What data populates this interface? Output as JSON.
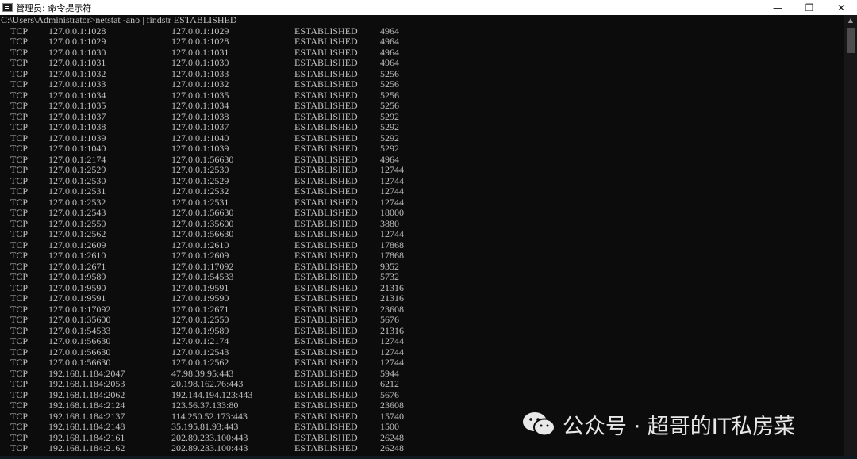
{
  "window": {
    "title": "管理员: 命令提示符",
    "minimize_glyph": "—",
    "maximize_glyph": "❐",
    "close_glyph": "✕",
    "icon": "cmd-icon"
  },
  "console": {
    "command": "C:\\Users\\Administrator>netstat -ano | findstr ESTABLISHED",
    "rows": [
      [
        "TCP",
        "127.0.0.1:1028",
        "127.0.0.1:1029",
        "ESTABLISHED",
        "4964"
      ],
      [
        "TCP",
        "127.0.0.1:1029",
        "127.0.0.1:1028",
        "ESTABLISHED",
        "4964"
      ],
      [
        "TCP",
        "127.0.0.1:1030",
        "127.0.0.1:1031",
        "ESTABLISHED",
        "4964"
      ],
      [
        "TCP",
        "127.0.0.1:1031",
        "127.0.0.1:1030",
        "ESTABLISHED",
        "4964"
      ],
      [
        "TCP",
        "127.0.0.1:1032",
        "127.0.0.1:1033",
        "ESTABLISHED",
        "5256"
      ],
      [
        "TCP",
        "127.0.0.1:1033",
        "127.0.0.1:1032",
        "ESTABLISHED",
        "5256"
      ],
      [
        "TCP",
        "127.0.0.1:1034",
        "127.0.0.1:1035",
        "ESTABLISHED",
        "5256"
      ],
      [
        "TCP",
        "127.0.0.1:1035",
        "127.0.0.1:1034",
        "ESTABLISHED",
        "5256"
      ],
      [
        "TCP",
        "127.0.0.1:1037",
        "127.0.0.1:1038",
        "ESTABLISHED",
        "5292"
      ],
      [
        "TCP",
        "127.0.0.1:1038",
        "127.0.0.1:1037",
        "ESTABLISHED",
        "5292"
      ],
      [
        "TCP",
        "127.0.0.1:1039",
        "127.0.0.1:1040",
        "ESTABLISHED",
        "5292"
      ],
      [
        "TCP",
        "127.0.0.1:1040",
        "127.0.0.1:1039",
        "ESTABLISHED",
        "5292"
      ],
      [
        "TCP",
        "127.0.0.1:2174",
        "127.0.0.1:56630",
        "ESTABLISHED",
        "4964"
      ],
      [
        "TCP",
        "127.0.0.1:2529",
        "127.0.0.1:2530",
        "ESTABLISHED",
        "12744"
      ],
      [
        "TCP",
        "127.0.0.1:2530",
        "127.0.0.1:2529",
        "ESTABLISHED",
        "12744"
      ],
      [
        "TCP",
        "127.0.0.1:2531",
        "127.0.0.1:2532",
        "ESTABLISHED",
        "12744"
      ],
      [
        "TCP",
        "127.0.0.1:2532",
        "127.0.0.1:2531",
        "ESTABLISHED",
        "12744"
      ],
      [
        "TCP",
        "127.0.0.1:2543",
        "127.0.0.1:56630",
        "ESTABLISHED",
        "18000"
      ],
      [
        "TCP",
        "127.0.0.1:2550",
        "127.0.0.1:35600",
        "ESTABLISHED",
        "3880"
      ],
      [
        "TCP",
        "127.0.0.1:2562",
        "127.0.0.1:56630",
        "ESTABLISHED",
        "12744"
      ],
      [
        "TCP",
        "127.0.0.1:2609",
        "127.0.0.1:2610",
        "ESTABLISHED",
        "17868"
      ],
      [
        "TCP",
        "127.0.0.1:2610",
        "127.0.0.1:2609",
        "ESTABLISHED",
        "17868"
      ],
      [
        "TCP",
        "127.0.0.1:2671",
        "127.0.0.1:17092",
        "ESTABLISHED",
        "9352"
      ],
      [
        "TCP",
        "127.0.0.1:9589",
        "127.0.0.1:54533",
        "ESTABLISHED",
        "5732"
      ],
      [
        "TCP",
        "127.0.0.1:9590",
        "127.0.0.1:9591",
        "ESTABLISHED",
        "21316"
      ],
      [
        "TCP",
        "127.0.0.1:9591",
        "127.0.0.1:9590",
        "ESTABLISHED",
        "21316"
      ],
      [
        "TCP",
        "127.0.0.1:17092",
        "127.0.0.1:2671",
        "ESTABLISHED",
        "23608"
      ],
      [
        "TCP",
        "127.0.0.1:35600",
        "127.0.0.1:2550",
        "ESTABLISHED",
        "5676"
      ],
      [
        "TCP",
        "127.0.0.1:54533",
        "127.0.0.1:9589",
        "ESTABLISHED",
        "21316"
      ],
      [
        "TCP",
        "127.0.0.1:56630",
        "127.0.0.1:2174",
        "ESTABLISHED",
        "12744"
      ],
      [
        "TCP",
        "127.0.0.1:56630",
        "127.0.0.1:2543",
        "ESTABLISHED",
        "12744"
      ],
      [
        "TCP",
        "127.0.0.1:56630",
        "127.0.0.1:2562",
        "ESTABLISHED",
        "12744"
      ],
      [
        "TCP",
        "192.168.1.184:2047",
        "47.98.39.95:443",
        "ESTABLISHED",
        "5944"
      ],
      [
        "TCP",
        "192.168.1.184:2053",
        "20.198.162.76:443",
        "ESTABLISHED",
        "6212"
      ],
      [
        "TCP",
        "192.168.1.184:2062",
        "192.144.194.123:443",
        "ESTABLISHED",
        "5676"
      ],
      [
        "TCP",
        "192.168.1.184:2124",
        "123.56.37.133:80",
        "ESTABLISHED",
        "23608"
      ],
      [
        "TCP",
        "192.168.1.184:2137",
        "114.250.52.173:443",
        "ESTABLISHED",
        "15740"
      ],
      [
        "TCP",
        "192.168.1.184:2148",
        "35.195.81.93:443",
        "ESTABLISHED",
        "1500"
      ],
      [
        "TCP",
        "192.168.1.184:2161",
        "202.89.233.100:443",
        "ESTABLISHED",
        "26248"
      ],
      [
        "TCP",
        "192.168.1.184:2162",
        "202.89.233.100:443",
        "ESTABLISHED",
        "26248"
      ]
    ]
  },
  "watermark": {
    "text": "公众号 · 超哥的IT私房菜",
    "icon": "wechat-icon"
  },
  "colors": {
    "console_bg": "#0c0c0c",
    "console_fg": "#c0c0c0",
    "titlebar_bg": "#ffffff"
  }
}
